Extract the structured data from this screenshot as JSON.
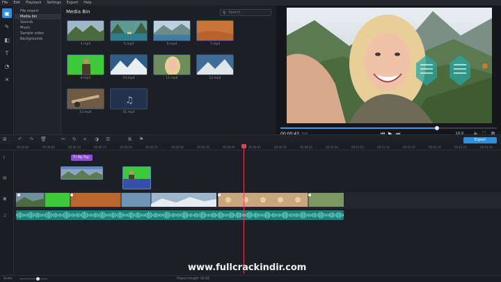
{
  "menu": [
    "File",
    "Edit",
    "Playback",
    "Settings",
    "Export",
    "Help"
  ],
  "tools": [
    {
      "icon": "import-icon",
      "glyph": "▣",
      "active": true
    },
    {
      "icon": "magic-wand-icon",
      "glyph": "✎",
      "active": false
    },
    {
      "icon": "filters-icon",
      "glyph": "◧",
      "active": false
    },
    {
      "icon": "titles-icon",
      "glyph": "T",
      "active": false
    },
    {
      "icon": "transitions-icon",
      "glyph": "◔",
      "active": false
    },
    {
      "icon": "more-tools-icon",
      "glyph": "✕",
      "active": false
    }
  ],
  "categories": [
    "File import",
    "Media bin",
    "Sounds",
    "Music",
    "Sample video",
    "Backgrounds"
  ],
  "active_category": "Media bin",
  "mediabin": {
    "title": "Media Bin",
    "search_placeholder": "Search",
    "items": [
      {
        "file": "4.mp4",
        "kind": "mountains"
      },
      {
        "file": "5.mp4",
        "kind": "lake-boat"
      },
      {
        "file": "6.mp4",
        "kind": "lake"
      },
      {
        "file": "7.mp4",
        "kind": "desert"
      },
      {
        "file": "8.mp4",
        "kind": "green-man"
      },
      {
        "file": "10.mp4",
        "kind": "snow-peaks"
      },
      {
        "file": "11.mp4",
        "kind": "woman"
      },
      {
        "file": "12.mp4",
        "kind": "snow-peaks2"
      },
      {
        "file": "13.mp4",
        "kind": "tools"
      },
      {
        "file": "41.mp3",
        "kind": "audio"
      }
    ]
  },
  "preview": {
    "time": "00:00:43",
    "total": "700",
    "ratio": "16:9",
    "progress": 0.72
  },
  "timeline": {
    "export_label": "Export",
    "ticks": [
      "00:00:00",
      "00:00:05",
      "00:00:10",
      "00:00:15",
      "00:00:20",
      "00:00:25",
      "00:00:30",
      "00:00:35",
      "00:00:40",
      "00:00:45",
      "00:00:50",
      "00:00:55",
      "00:01:00",
      "00:01:05",
      "00:01:10",
      "00:01:15",
      "00:01:20",
      "00:01:25",
      "00:01:30"
    ],
    "title_clip": "My Trip"
  },
  "watermark": "www.fullcrackindir.com",
  "status": {
    "scale_label": "Scale:",
    "project_length": "Project length: 01:02"
  },
  "colors": {
    "accent": "#2f8fd8",
    "title_clip": "#8f4fd3",
    "audio_wave": "#1c7f78",
    "playhead": "#e0425a"
  }
}
